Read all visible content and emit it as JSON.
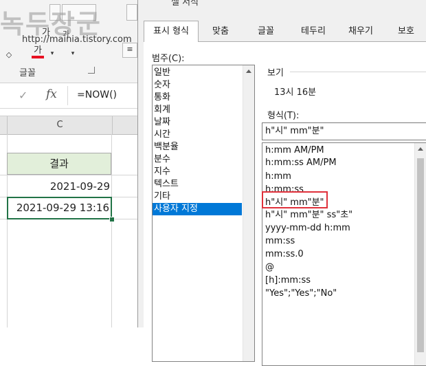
{
  "ribbon": {
    "watermark": "녹두장군",
    "url": "http://mainia.tistory.com",
    "font_size_label": "가",
    "font_small_label": "가",
    "font_color_label": "가",
    "group_label": "글꼴"
  },
  "formula_bar": {
    "check": "✓",
    "fx": "fx",
    "formula": "=NOW()"
  },
  "sheet": {
    "column_label": "C",
    "header_cell": "결과",
    "value1": "2021-09-29",
    "value2": "2021-09-29 13:16",
    "accent_color": "#217346",
    "header_fill": "#e2efda"
  },
  "dialog": {
    "title": "셀 서식",
    "tabs": [
      "표시 형식",
      "맞춤",
      "글꼴",
      "테두리",
      "채우기",
      "보호"
    ],
    "active_tab": "표시 형식",
    "category_label": "범주(C):",
    "categories": [
      "일반",
      "숫자",
      "통화",
      "회계",
      "날짜",
      "시간",
      "백분율",
      "분수",
      "지수",
      "텍스트",
      "기타",
      "사용자 지정"
    ],
    "selected_category": "사용자 지정",
    "sample_label": "보기",
    "sample_value": "13시 16분",
    "type_label": "형식(T):",
    "type_value": "h\"시\" mm\"분\"",
    "formats": [
      "h:mm AM/PM",
      "h:mm:ss AM/PM",
      "h:mm",
      "h:mm:ss",
      "h\"시\" mm\"분\"",
      "h\"시\" mm\"분\" ss\"초\"",
      "yyyy-mm-dd h:mm",
      "mm:ss",
      "mm:ss.0",
      "@",
      "[h]:mm:ss",
      "\"Yes\";\"Yes\";\"No\""
    ],
    "highlighted_format": "h\"시\" mm\"분\"",
    "selection_color": "#0078d7",
    "highlight_color": "#e0303a"
  }
}
